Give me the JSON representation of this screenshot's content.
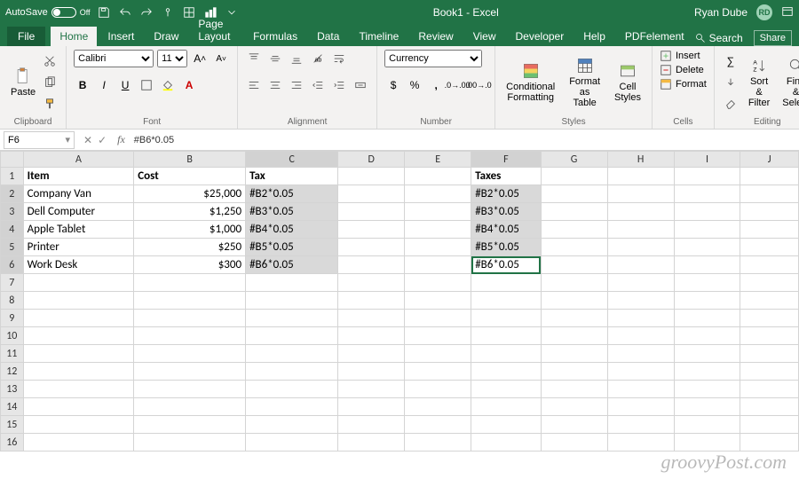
{
  "titlebar": {
    "autosave_label": "AutoSave",
    "autosave_state": "Off",
    "document_title": "Book1 - Excel",
    "user_name": "Ryan Dube",
    "user_initials": "RD"
  },
  "tabs": {
    "file": "File",
    "items": [
      "Home",
      "Insert",
      "Draw",
      "Page Layout",
      "Formulas",
      "Data",
      "Timeline",
      "Review",
      "View",
      "Developer",
      "Help",
      "PDFelement"
    ],
    "active": "Home",
    "search": "Search",
    "share": "Share"
  },
  "ribbon": {
    "clipboard": {
      "label": "Clipboard",
      "paste": "Paste"
    },
    "font": {
      "label": "Font",
      "name": "Calibri",
      "size": "11"
    },
    "alignment": {
      "label": "Alignment"
    },
    "number": {
      "label": "Number",
      "format": "Currency"
    },
    "styles": {
      "label": "Styles",
      "conditional": "Conditional Formatting",
      "format_table": "Format as Table",
      "cell_styles": "Cell Styles"
    },
    "cells": {
      "label": "Cells",
      "insert": "Insert",
      "delete": "Delete",
      "format": "Format"
    },
    "editing": {
      "label": "Editing",
      "sort": "Sort & Filter",
      "find": "Find & Select"
    }
  },
  "formula_bar": {
    "cell_ref": "F6",
    "formula": "#B6*0.05"
  },
  "sheet": {
    "columns": [
      "A",
      "B",
      "C",
      "D",
      "E",
      "F",
      "G",
      "H",
      "I",
      "J"
    ],
    "row_count": 16,
    "headers": {
      "A": "Item",
      "B": "Cost",
      "C": "Tax",
      "F": "Taxes"
    },
    "rows": [
      {
        "A": "Company Van",
        "B": "$25,000",
        "C": "#B2*0.05",
        "F": "#B2*0.05"
      },
      {
        "A": "Dell Computer",
        "B": "$1,250",
        "C": "#B3*0.05",
        "F": "#B3*0.05"
      },
      {
        "A": "Apple Tablet",
        "B": "$1,000",
        "C": "#B4*0.05",
        "F": "#B4*0.05"
      },
      {
        "A": "Printer",
        "B": "$250",
        "C": "#B5*0.05",
        "F": "#B5*0.05"
      },
      {
        "A": "Work Desk",
        "B": "$300",
        "C": "#B6*0.05",
        "F": "#B6*0.05"
      }
    ],
    "selected_cols": [
      "C",
      "F"
    ],
    "active_cell": "F6"
  },
  "watermark": "groovyPost.com"
}
